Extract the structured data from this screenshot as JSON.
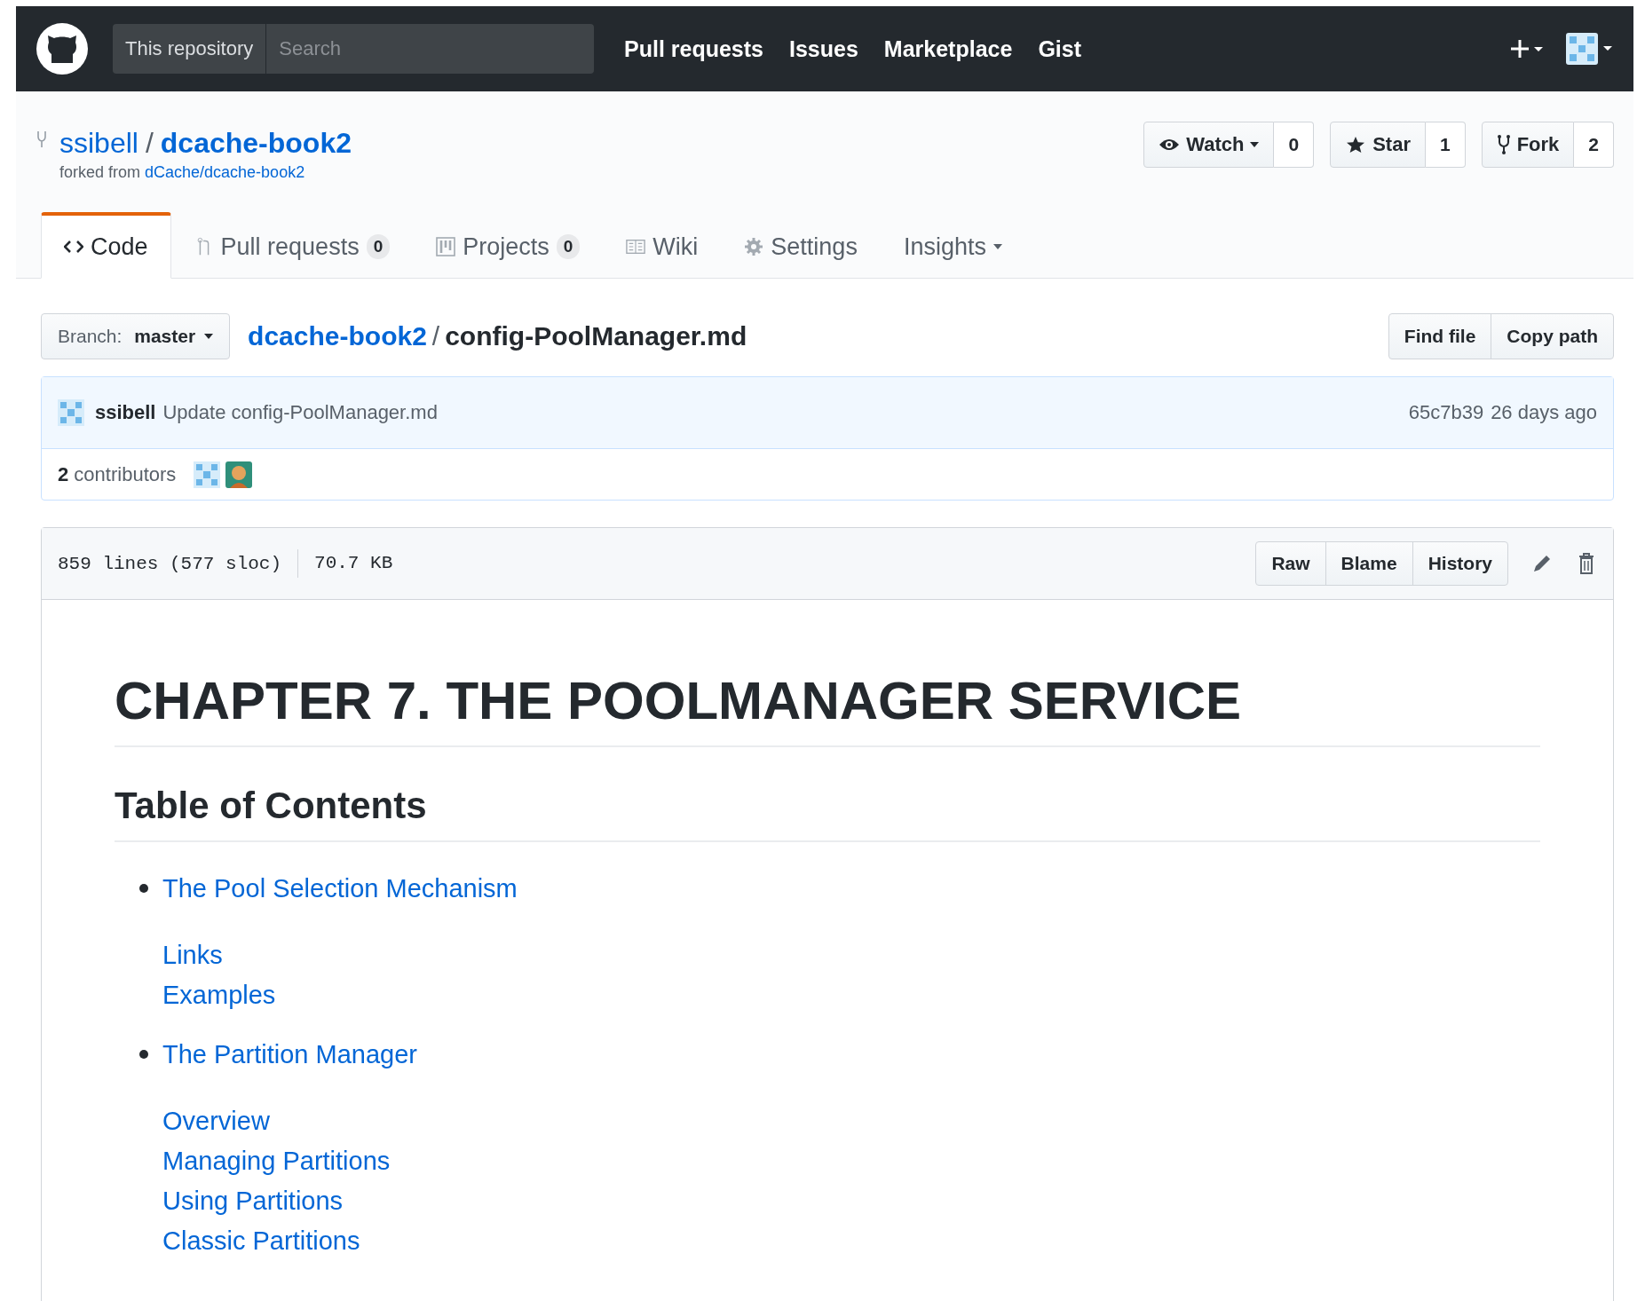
{
  "header": {
    "search_scope": "This repository",
    "search_placeholder": "Search",
    "nav": [
      "Pull requests",
      "Issues",
      "Marketplace",
      "Gist"
    ]
  },
  "repo": {
    "owner": "ssibell",
    "separator": "/",
    "name": "dcache-book2",
    "forked_prefix": "forked from",
    "forked_link": "dCache/dcache-book2",
    "actions": [
      {
        "kind": "watch",
        "label": "Watch",
        "count": "0",
        "dropdown": true
      },
      {
        "kind": "star",
        "label": "Star",
        "count": "1",
        "dropdown": false
      },
      {
        "kind": "fork",
        "label": "Fork",
        "count": "2",
        "dropdown": false
      }
    ]
  },
  "tabs": [
    {
      "kind": "code",
      "label": "Code",
      "selected": true,
      "dropdown": false
    },
    {
      "kind": "pull-requests",
      "label": "Pull requests",
      "counter": "0",
      "selected": false,
      "dropdown": false
    },
    {
      "kind": "projects",
      "label": "Projects",
      "counter": "0",
      "selected": false,
      "dropdown": false
    },
    {
      "kind": "wiki",
      "label": "Wiki",
      "selected": false,
      "dropdown": false
    },
    {
      "kind": "settings",
      "label": "Settings",
      "selected": false,
      "dropdown": false
    },
    {
      "kind": "insights",
      "label": "Insights",
      "selected": false,
      "dropdown": true
    }
  ],
  "branch": {
    "prefix": "Branch:",
    "name": "master"
  },
  "breadcrumb": {
    "repo": "dcache-book2",
    "separator": "/",
    "file": "config-PoolManager.md"
  },
  "file_buttons": [
    "Find file",
    "Copy path"
  ],
  "commit": {
    "author": "ssibell",
    "message": "Update config-PoolManager.md",
    "sha": "65c7b39",
    "age": "26 days ago"
  },
  "contributors": {
    "count": "2",
    "label": "contributors"
  },
  "file": {
    "lines": "859 lines (577 sloc)",
    "size": "70.7 KB",
    "buttons": [
      "Raw",
      "Blame",
      "History"
    ]
  },
  "content": {
    "title": "CHAPTER 7. THE POOLMANAGER SERVICE",
    "toc_title": "Table of Contents",
    "toc": [
      {
        "text": "The Pool Selection Mechanism",
        "children": [
          {
            "text": "Links"
          },
          {
            "text": "Examples"
          }
        ]
      },
      {
        "text": "The Partition Manager",
        "children": [
          {
            "text": "Overview"
          },
          {
            "text": "Managing Partitions"
          },
          {
            "text": "Using Partitions"
          },
          {
            "text": "Classic Partitions"
          }
        ]
      }
    ]
  }
}
